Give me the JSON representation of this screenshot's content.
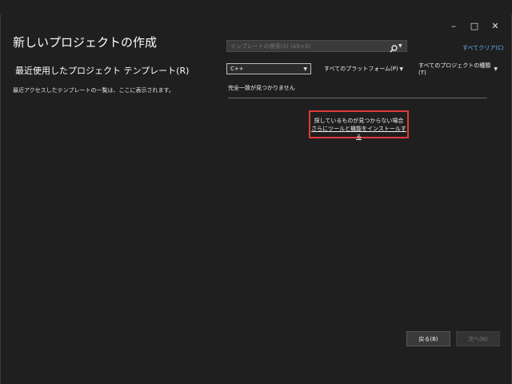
{
  "window": {
    "minimize": "–",
    "maximize": "□",
    "close": "✕"
  },
  "header": {
    "title": "新しいプロジェクトの作成"
  },
  "recent": {
    "title": "最近使用したプロジェクト テンプレート(R)",
    "description": "最近アクセスしたテンプレートの一覧は、ここに表示されます。"
  },
  "search": {
    "placeholder": "テンプレートの検索(S) (Alt+S)",
    "icon": "search-icon"
  },
  "filters": {
    "clear_all": "すべてクリア(C)",
    "language": "C++",
    "platform": "すべてのプラットフォーム(P)",
    "project_type": "すべてのプロジェクトの種類(T)"
  },
  "results": {
    "no_match": "完全一致が見つかりません",
    "help_line1": "探しているものが見つからない場合",
    "help_link": "さらにツールと機能をインストールする"
  },
  "buttons": {
    "back": "戻る(B)",
    "next": "次へ(N)"
  },
  "colors": {
    "background": "#1f1f1f",
    "link": "#6fb3ff",
    "highlight": "#e23a3a"
  }
}
